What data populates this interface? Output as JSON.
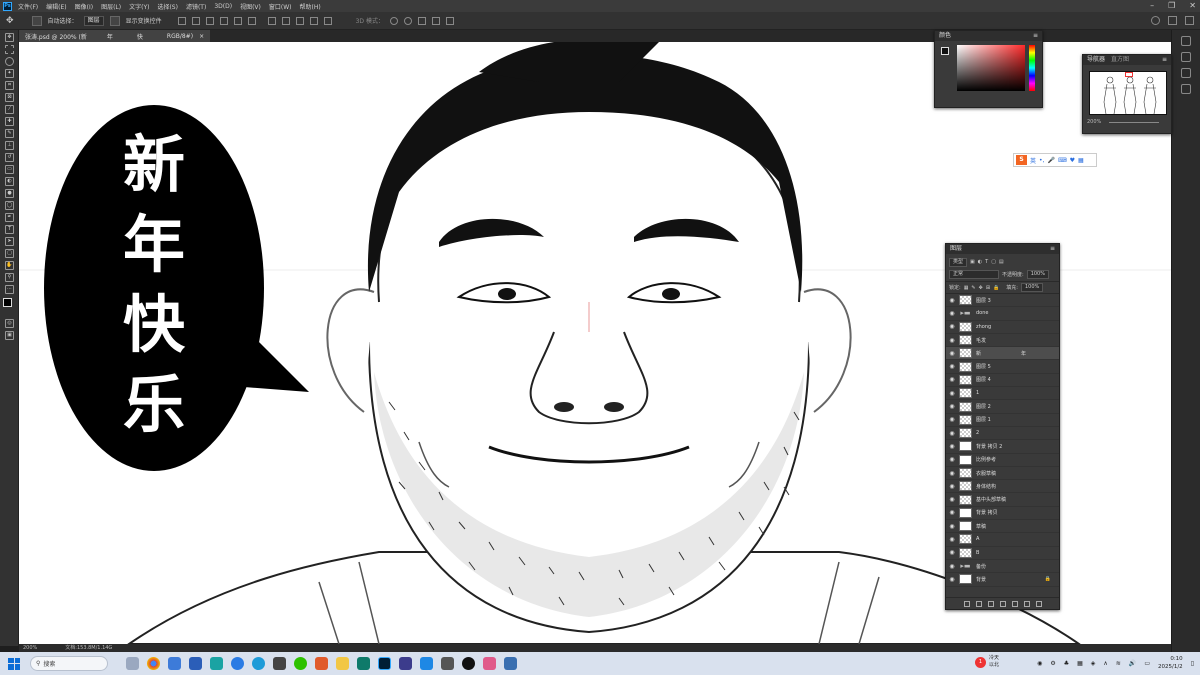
{
  "app": {
    "logo": "Ps",
    "menu": [
      "文件(F)",
      "编辑(E)",
      "图像(I)",
      "图层(L)",
      "文字(Y)",
      "选择(S)",
      "滤镜(T)",
      "3D(D)",
      "视图(V)",
      "窗口(W)",
      "帮助(H)"
    ]
  },
  "options_bar": {
    "auto_select_label": "自动选择：",
    "auto_select_value": "图层",
    "show_transform_label": "显示变换控件",
    "mode_3d_label": "3D 模式："
  },
  "document_tab": {
    "name": "张涛.psd @ 200% (新",
    "mid_char": "年",
    "mid_char2": "快",
    "mode": "RGB/8#)",
    "close": "×"
  },
  "canvas": {
    "speech_text": [
      "新",
      "年",
      "快",
      "乐"
    ]
  },
  "status_bar": {
    "zoom": "200%",
    "doc_info": "文档:153.8M/1.14G"
  },
  "color_panel": {
    "title": "颜色"
  },
  "navigator_panel": {
    "tabs": [
      "导航器",
      "直方图"
    ],
    "zoom": "200%"
  },
  "ime": {
    "logo": "S",
    "mode": "英"
  },
  "layers_panel": {
    "title": "图层",
    "filter_label": "类型",
    "blend_mode": "正常",
    "opacity_label": "不透明度:",
    "opacity_value": "100%",
    "lock_label": "锁定:",
    "fill_label": "填充:",
    "fill_value": "100%",
    "active_layer_extra": "年",
    "layers": [
      {
        "name": "图层 3",
        "kind": "layer"
      },
      {
        "name": "done",
        "kind": "folder"
      },
      {
        "name": "zhong",
        "kind": "layer"
      },
      {
        "name": "毛发",
        "kind": "layer"
      },
      {
        "name": "新",
        "kind": "layer",
        "active": true
      },
      {
        "name": "图层 5",
        "kind": "layer"
      },
      {
        "name": "图层 4",
        "kind": "layer"
      },
      {
        "name": "1",
        "kind": "layer"
      },
      {
        "name": "图层 2",
        "kind": "layer"
      },
      {
        "name": "图层 1",
        "kind": "layer"
      },
      {
        "name": "2",
        "kind": "layer"
      },
      {
        "name": "背景 拷贝 2",
        "kind": "white"
      },
      {
        "name": "比例参考",
        "kind": "white"
      },
      {
        "name": "衣服草稿",
        "kind": "layer"
      },
      {
        "name": "身体结构",
        "kind": "layer"
      },
      {
        "name": "基中头部草稿",
        "kind": "layer"
      },
      {
        "name": "背景 拷贝",
        "kind": "white"
      },
      {
        "name": "草稿",
        "kind": "white"
      },
      {
        "name": "A",
        "kind": "layer"
      },
      {
        "name": "B",
        "kind": "layer"
      },
      {
        "name": "备份",
        "kind": "folder"
      },
      {
        "name": "背景",
        "kind": "white",
        "locked": true
      }
    ]
  },
  "taskbar": {
    "search_placeholder": "搜索",
    "weather_temp": "冷天",
    "weather_desc": "以北",
    "time": "0:10",
    "date": "2025/1/2",
    "notification_count": "1"
  },
  "colors": {
    "ps_blue": "#31a8ff",
    "panel_bg": "#3a3a3a",
    "taskbar_bg": "#d9e1ee"
  }
}
